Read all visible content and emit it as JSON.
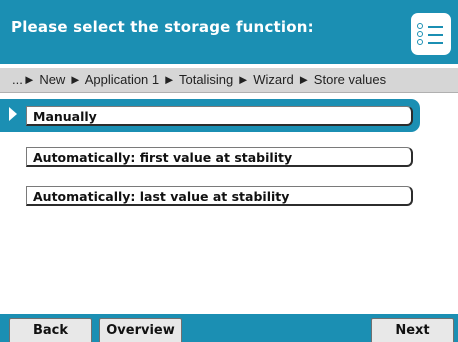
{
  "header": {
    "title": "Please select the storage function:",
    "menu_icon": "list-menu-icon",
    "accent_color": "#1b8fb3"
  },
  "breadcrumb": {
    "text": "...► New ► Application 1 ► Totalising ► Wizard ► Store values"
  },
  "options": {
    "selected_index": 0,
    "items": [
      {
        "label": "Manually"
      },
      {
        "label": "Automatically: first value at stability"
      },
      {
        "label": "Automatically: last value at stability"
      }
    ]
  },
  "softkeys": {
    "back": "Back",
    "overview": "Overview",
    "next": "Next"
  }
}
